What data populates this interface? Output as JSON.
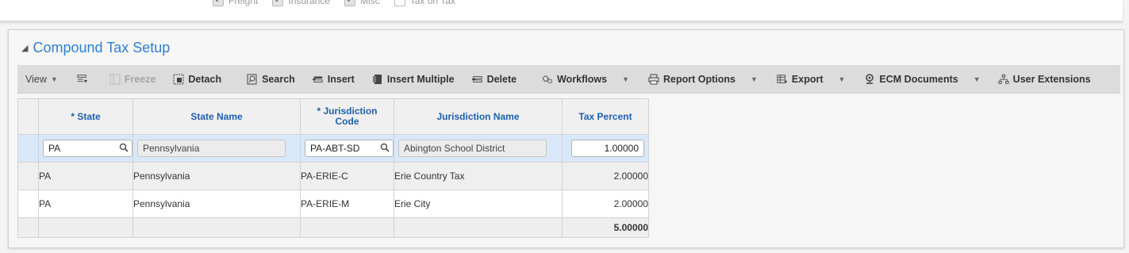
{
  "top_checkboxes": [
    {
      "label": "Freight",
      "checked": true
    },
    {
      "label": "Insurance",
      "checked": true
    },
    {
      "label": "Misc",
      "checked": true
    },
    {
      "label": "Tax on Tax",
      "checked": false
    }
  ],
  "panel": {
    "title": "Compound Tax Setup"
  },
  "toolbar": {
    "view": "View",
    "freeze": "Freeze",
    "detach": "Detach",
    "search": "Search",
    "insert": "Insert",
    "insert_multiple": "Insert Multiple",
    "delete": "Delete",
    "workflows": "Workflows",
    "report_options": "Report Options",
    "export": "Export",
    "ecm_documents": "ECM Documents",
    "user_extensions": "User Extensions"
  },
  "grid": {
    "headers": {
      "state": "* State",
      "state_name": "State Name",
      "jurisdiction_code_1": "* Jurisdiction",
      "jurisdiction_code_2": "Code",
      "jurisdiction_name": "Jurisdiction Name",
      "tax_percent": "Tax Percent"
    },
    "rows": [
      {
        "state": "PA",
        "state_name": "Pennsylvania",
        "jurisdiction_code": "PA-ABT-SD",
        "jurisdiction_name": "Abington School District",
        "tax_percent": "1.00000"
      },
      {
        "state": "PA",
        "state_name": "Pennsylvania",
        "jurisdiction_code": "PA-ERIE-C",
        "jurisdiction_name": "Erie Country Tax",
        "tax_percent": "2.00000"
      },
      {
        "state": "PA",
        "state_name": "Pennsylvania",
        "jurisdiction_code": "PA-ERIE-M",
        "jurisdiction_name": "Erie City",
        "tax_percent": "2.00000"
      }
    ],
    "total": "5.00000"
  },
  "colors": {
    "accent": "#2f7fd1",
    "header_text": "#1f5fae",
    "selected_row": "#d9e8f8",
    "toolbar_bg": "#dcdcdc"
  }
}
